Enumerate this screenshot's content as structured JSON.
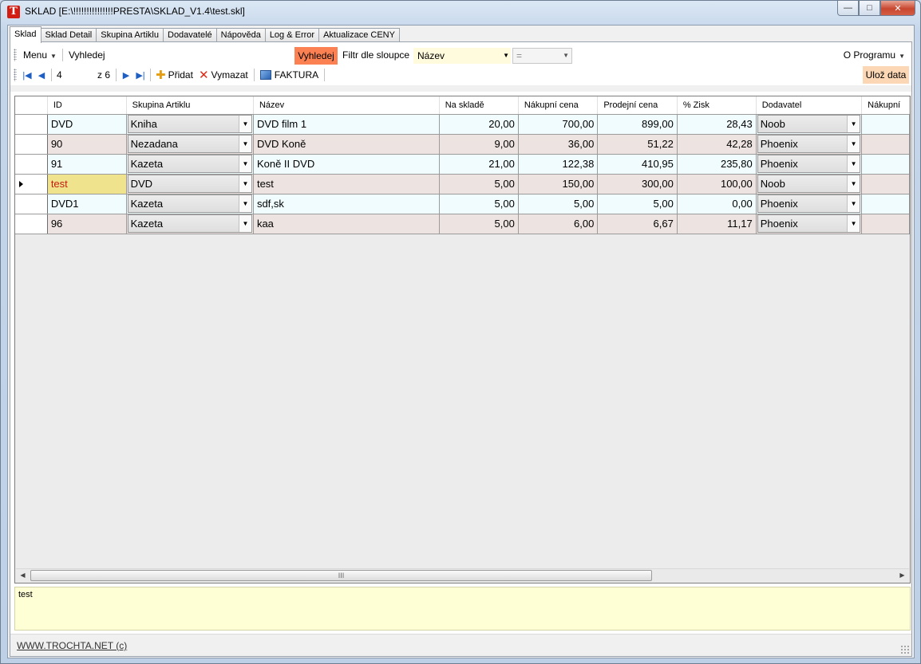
{
  "window": {
    "title": "SKLAD [E:\\!!!!!!!!!!!!!!!PRESTA\\SKLAD_V1.4\\test.skl]",
    "app_icon_letter": "T",
    "controls": {
      "minimize": "—",
      "maximize": "□",
      "close": "✕"
    }
  },
  "tabs": [
    {
      "label": "Sklad",
      "active": true
    },
    {
      "label": "Sklad Detail"
    },
    {
      "label": "Skupina Artiklu"
    },
    {
      "label": "Dodavatelé"
    },
    {
      "label": "Nápověda"
    },
    {
      "label": "Log & Error"
    },
    {
      "label": "Aktualizace CENY"
    }
  ],
  "toolbar": {
    "menu_label": "Menu",
    "search_label": "Vyhledej",
    "search_button": "Vyhledej",
    "filter_label": "Filtr dle sloupce",
    "filter_column": "Název",
    "filter_operator": "=",
    "about_label": "O Programu",
    "position": "4",
    "of_count": "z 6",
    "add_label": "Přidat",
    "delete_label": "Vymazat",
    "invoice_label": "FAKTURA",
    "save_label": "Ulož data"
  },
  "grid": {
    "columns": [
      "ID",
      "Skupina Artiklu",
      "Název",
      "Na skladě",
      "Nákupní cena",
      "Prodejní cena",
      "% Zisk",
      "Dodavatel",
      "Nákupní"
    ],
    "current_row": 3,
    "rows": [
      {
        "id": "DVD",
        "group": "Kniha",
        "name": "DVD film 1",
        "stock": "20,00",
        "buy": "700,00",
        "sell": "899,00",
        "profit": "28,43",
        "supplier": "Noob"
      },
      {
        "id": "90",
        "group": "Nezadana",
        "name": "DVD Koně",
        "stock": "9,00",
        "buy": "36,00",
        "sell": "51,22",
        "profit": "42,28",
        "supplier": "Phoenix"
      },
      {
        "id": "91",
        "group": "Kazeta",
        "name": "Koně II DVD",
        "stock": "21,00",
        "buy": "122,38",
        "sell": "410,95",
        "profit": "235,80",
        "supplier": "Phoenix"
      },
      {
        "id": "test",
        "group": "DVD",
        "name": "test",
        "stock": "5,00",
        "buy": "150,00",
        "sell": "300,00",
        "profit": "100,00",
        "supplier": "Noob"
      },
      {
        "id": "DVD1",
        "group": "Kazeta",
        "name": "sdf,sk",
        "stock": "5,00",
        "buy": "5,00",
        "sell": "5,00",
        "profit": "0,00",
        "supplier": "Phoenix"
      },
      {
        "id": "96",
        "group": "Kazeta",
        "name": "kaa",
        "stock": "5,00",
        "buy": "6,00",
        "sell": "6,67",
        "profit": "11,17",
        "supplier": "Phoenix"
      }
    ],
    "scroll_thumb": "III"
  },
  "note": {
    "text": "test"
  },
  "status": {
    "link": "WWW.TROCHTA.NET (c)"
  },
  "colors": {
    "search_button": "#fb8153",
    "save_button": "#fbd7b5",
    "row_odd": "#f0fcfd",
    "row_even": "#ede3e1",
    "current_id_bg": "#f0e38e",
    "current_id_text": "#c41b0e",
    "note_bg": "#ffffd6"
  }
}
